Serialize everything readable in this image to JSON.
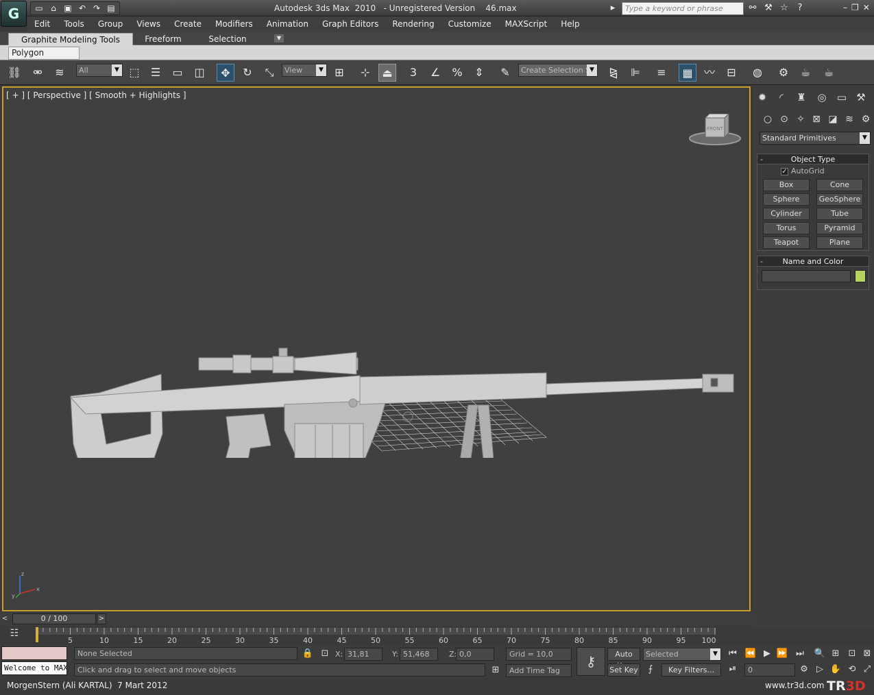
{
  "app": {
    "title": "Autodesk 3ds Max  2010   - Unregistered Version    46.max",
    "logo_letter": "G",
    "quick_access_icons": [
      "new-file-icon",
      "open-file-icon",
      "save-icon",
      "undo-icon",
      "redo-icon",
      "project-folder-icon"
    ],
    "search_placeholder": "Type a keyword or phrase",
    "help_icons": [
      "binoculars-icon",
      "tools-icon",
      "star-icon",
      "help-icon"
    ],
    "window_controls": [
      "–",
      "❐",
      "✕"
    ]
  },
  "menu": {
    "items": [
      "Edit",
      "Tools",
      "Group",
      "Views",
      "Create",
      "Modifiers",
      "Animation",
      "Graph Editors",
      "Rendering",
      "Customize",
      "MAXScript",
      "Help"
    ]
  },
  "ribbon": {
    "tabs": [
      "Graphite Modeling Tools",
      "Freeform",
      "Selection"
    ],
    "active_panel": "Polygon Modeling"
  },
  "toolbar": {
    "filter_value": "All",
    "refcoord_value": "View",
    "selection_set_placeholder": "Create Selection Se",
    "snap_label": "3"
  },
  "viewport": {
    "label": "[ + ] [ Perspective ] [ Smooth + Highlights ]",
    "viewcube_face": "FRONT",
    "axis_labels": [
      "z",
      "y",
      "x"
    ]
  },
  "command_panel": {
    "tab_icons": [
      "create-tab-icon",
      "modify-tab-icon",
      "hierarchy-tab-icon",
      "motion-tab-icon",
      "display-tab-icon",
      "utilities-tab-icon"
    ],
    "category_icons": [
      "geometry-icon",
      "shapes-icon",
      "lights-icon",
      "cameras-icon",
      "helpers-icon",
      "spacewarps-icon",
      "systems-icon"
    ],
    "primitive_type": "Standard Primitives",
    "object_type": {
      "title": "Object Type",
      "autogrid_label": "AutoGrid",
      "buttons": [
        "Box",
        "Cone",
        "Sphere",
        "GeoSphere",
        "Cylinder",
        "Tube",
        "Torus",
        "Pyramid",
        "Teapot",
        "Plane"
      ]
    },
    "name_and_color": {
      "title": "Name and Color",
      "color": "#b6d35c"
    }
  },
  "timeline": {
    "slider_text": "0 / 100",
    "prev_arrow": "<",
    "next_arrow": ">",
    "tick_labels": [
      "5",
      "10",
      "15",
      "20",
      "25",
      "30",
      "35",
      "40",
      "45",
      "50",
      "55",
      "60",
      "65",
      "70",
      "75",
      "80",
      "85",
      "90",
      "95",
      "100"
    ]
  },
  "status": {
    "maxscript_listener": "Welcome to MAXScript",
    "selection": "None Selected",
    "prompt": "Click and drag to select and move objects",
    "x_label": "X:",
    "x_value": "31,81",
    "y_label": "Y:",
    "y_value": "51,468",
    "z_label": "Z:",
    "z_value": "0,0",
    "grid": "Grid = 10,0",
    "add_time_tag": "Add Time Tag",
    "auto_key": "Auto Key",
    "set_key": "Set Key",
    "selected_filter": "Selected",
    "key_filters": "Key Filters...",
    "frame_value": "0"
  },
  "footer": {
    "credit": "MorgenStern (Ali KARTAL)  7 Mart 2012",
    "site": "www.tr3d.com",
    "logo_a": "TR",
    "logo_b": "3D"
  }
}
